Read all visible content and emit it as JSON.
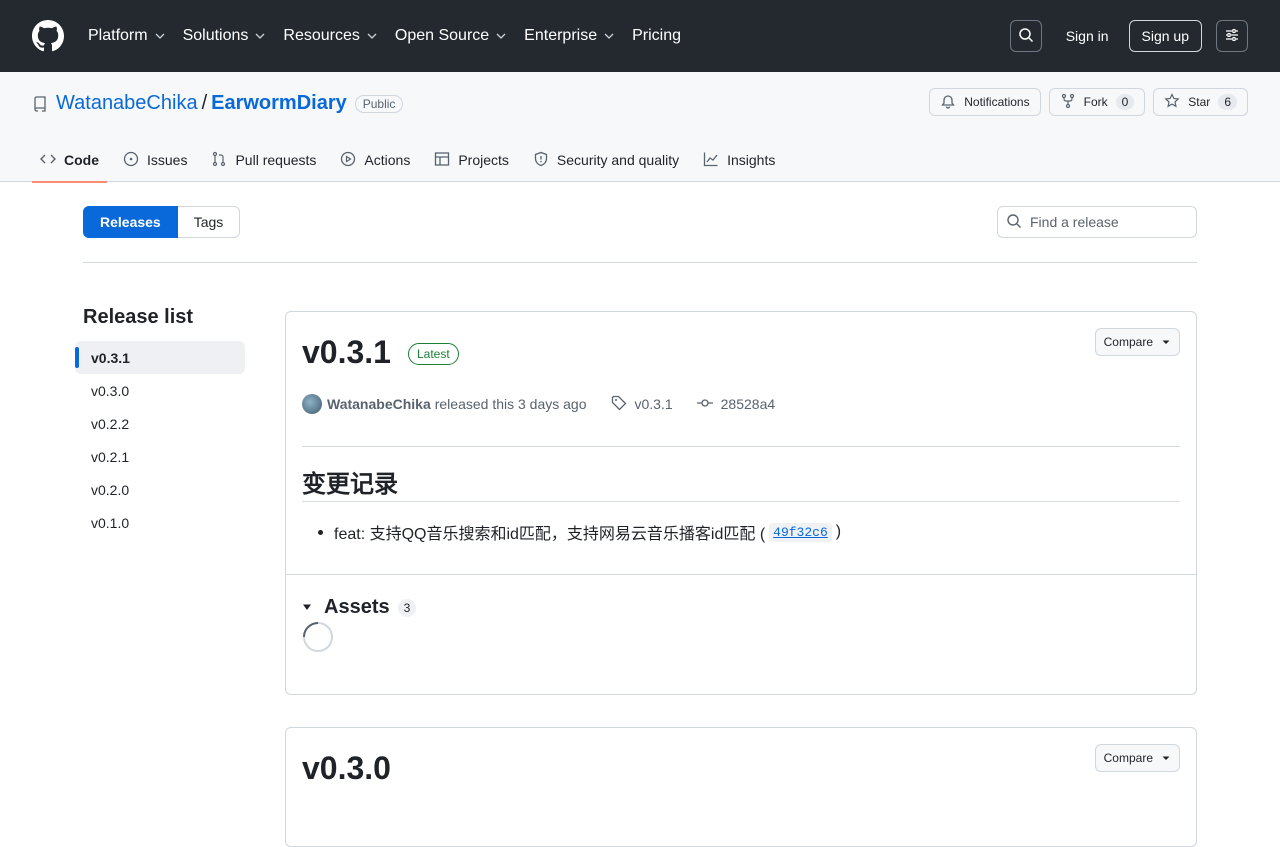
{
  "header": {
    "nav": [
      "Platform",
      "Solutions",
      "Resources",
      "Open Source",
      "Enterprise",
      "Pricing"
    ],
    "nav_has_chevron": [
      true,
      true,
      true,
      true,
      true,
      false
    ],
    "signin": "Sign in",
    "signup": "Sign up"
  },
  "repo": {
    "owner": "WatanabeChika",
    "slash": "/",
    "name": "EarwormDiary",
    "visibility": "Public",
    "notifications": "Notifications",
    "fork_label": "Fork",
    "fork_count": "0",
    "star_label": "Star",
    "star_count": "6"
  },
  "tabs": [
    "Code",
    "Issues",
    "Pull requests",
    "Actions",
    "Projects",
    "Security and quality",
    "Insights"
  ],
  "subnav": {
    "releases": "Releases",
    "tags": "Tags",
    "find_placeholder": "Find a release"
  },
  "release_list": {
    "title": "Release list",
    "items": [
      "v0.3.1",
      "v0.3.0",
      "v0.2.2",
      "v0.2.1",
      "v0.2.0",
      "v0.1.0"
    ],
    "selected_index": 0
  },
  "release": {
    "version": "v0.3.1",
    "badge": "Latest",
    "compare": "Compare",
    "author": "WatanabeChika",
    "released_text": "released this 3 days ago",
    "tag": "v0.3.1",
    "commit": "28528a4",
    "changelog_heading": "变更记录",
    "bullet_text": "feat: 支持QQ音乐搜索和id匹配，支持网易云音乐播客id匹配 (",
    "bullet_commit": "49f32c6",
    "bullet_close": ")",
    "assets_label": "Assets",
    "assets_count": "3"
  },
  "release2": {
    "version": "v0.3.0",
    "compare": "Compare"
  },
  "colors": {
    "header_bg": "#24292f",
    "accent": "#0969da",
    "latest_green": "#1a7f37",
    "active_tab_underline": "#fd8c73"
  }
}
